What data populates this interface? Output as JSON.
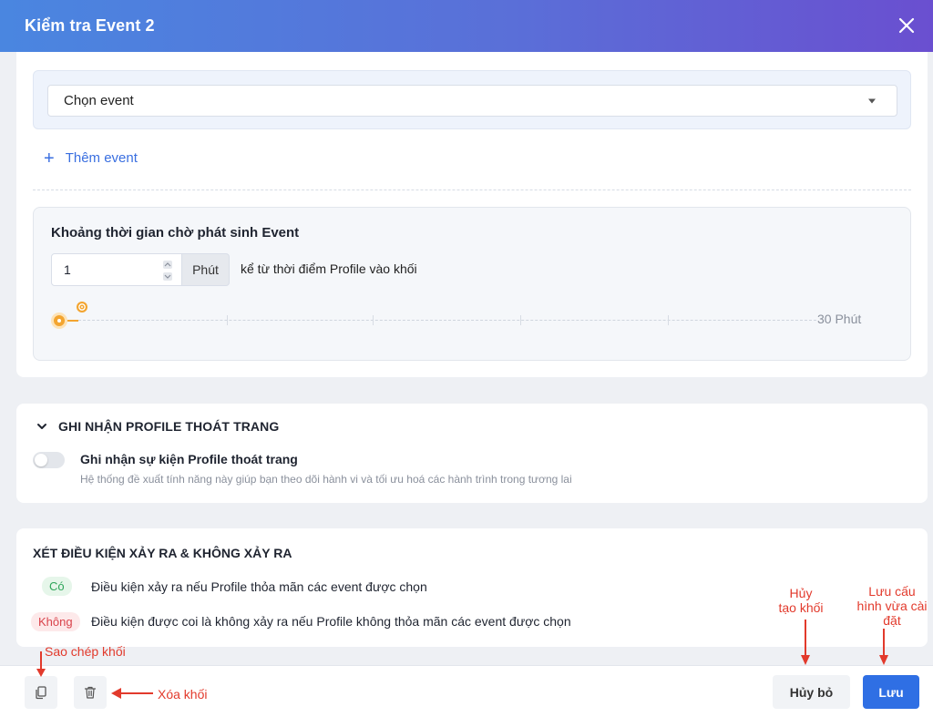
{
  "header": {
    "title": "Kiểm tra Event 2"
  },
  "event_select": {
    "value": "Chọn event"
  },
  "add_event": {
    "label": "Thêm event"
  },
  "wait": {
    "title": "Khoảng thời gian chờ phát sinh Event",
    "value": "1",
    "unit": "Phút",
    "since": "kể từ thời điểm Profile vào khối",
    "slider_max_label": "30 Phút",
    "slider_value_fraction": 0.033
  },
  "exit_section": {
    "title": "GHI NHẬN PROFILE THOÁT TRANG",
    "toggle_label": "Ghi nhận sự kiện Profile thoát trang",
    "toggle_on": false,
    "description": "Hệ thống đề xuất tính năng này giúp bạn theo dõi hành vi và tối ưu hoá các hành trình trong tương lai"
  },
  "condition_section": {
    "title": "XÉT ĐIỀU KIỆN XẢY RA & KHÔNG XẢY RA",
    "yes_tag": "Có",
    "yes_text": "Điều kiện xảy ra nếu Profile thỏa mãn các event được chọn",
    "no_tag": "Không",
    "no_text": "Điều kiện được coi là không xảy ra nếu Profile không thỏa mãn các event được chọn"
  },
  "footer": {
    "cancel_label": "Hủy bỏ",
    "save_label": "Lưu"
  },
  "annotations": {
    "copy": "Sao chép khối",
    "delete": "Xóa khối",
    "cancel_line1": "Hủy",
    "cancel_line2": "tạo khối",
    "save_line1": "Lưu cấu",
    "save_line2": "hình vừa cài",
    "save_line3": "đặt"
  },
  "colors": {
    "accent": "#2f6fe4",
    "annotation": "#e23a2c",
    "slider": "#f3a530"
  }
}
